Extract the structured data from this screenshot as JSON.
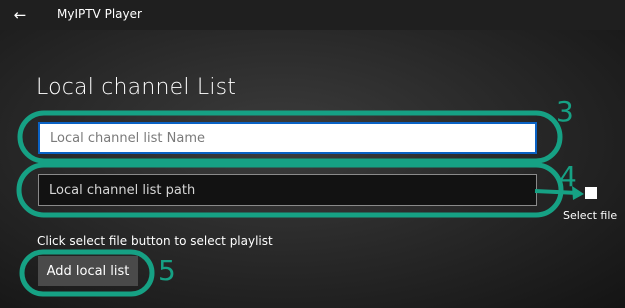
{
  "titlebar": {
    "back_icon": "back-arrow-icon",
    "back_glyph": "←",
    "title": "MyIPTV Player"
  },
  "page": {
    "title": "Local channel List"
  },
  "form": {
    "name_placeholder": "Local channel list Name",
    "path_placeholder": "Local channel list path",
    "select_file_label": "Select file",
    "hint": "Click select file button to select playlist",
    "add_button_label": "Add local list"
  },
  "annotations": {
    "color": "#16a184",
    "numbers": [
      "3",
      "4",
      "5"
    ]
  }
}
